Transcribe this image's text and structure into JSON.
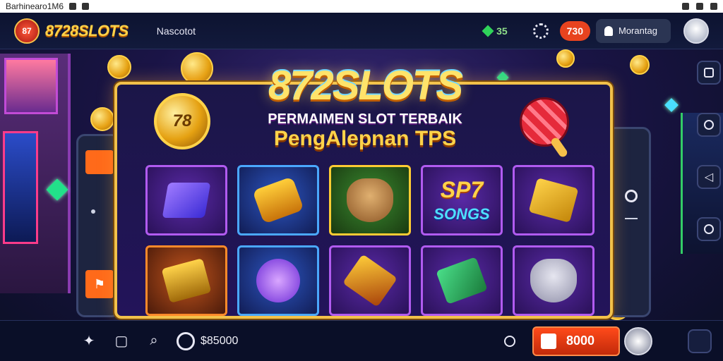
{
  "status_bar": {
    "carrier": "Barhinearo1M6"
  },
  "header": {
    "brand": "8728SLOTS",
    "logo_badge": "87",
    "nav_label": "Nascotot",
    "gem_count": "35",
    "coins": "730",
    "user_label": "Morantag"
  },
  "hero": {
    "title": "872SLOTS",
    "subtitle_line1": "PERMAIMEN SLOT TERBAIK",
    "subtitle_line2": "PengAlepnan TPS",
    "medal_label": "78"
  },
  "tiles": [
    {
      "name": "tile-purple-card",
      "style": "purple",
      "art": "a1"
    },
    {
      "name": "tile-golden-ticket",
      "style": "blue",
      "art": "a2"
    },
    {
      "name": "tile-bear",
      "style": "gold",
      "art": "a3"
    },
    {
      "name": "tile-sp7-songs",
      "style": "purple",
      "text_big": "SP7",
      "text_small": "SONGS"
    },
    {
      "name": "tile-treasure-box",
      "style": "purple",
      "art": "a5"
    },
    {
      "name": "tile-gold-bar",
      "style": "orange",
      "art": "a6"
    },
    {
      "name": "tile-orb",
      "style": "blue",
      "art": "a7"
    },
    {
      "name": "tile-crossed-gold",
      "style": "purple",
      "art": "a8"
    },
    {
      "name": "tile-green-card",
      "style": "purple",
      "art": "a9"
    },
    {
      "name": "tile-cat",
      "style": "purple",
      "art": "a10"
    }
  ],
  "bottom_bar": {
    "amount": "$85000",
    "balance": "8000"
  },
  "colors": {
    "accent_gold": "#ffd34a",
    "accent_orange": "#e8431f",
    "background": "#0b0f24"
  }
}
